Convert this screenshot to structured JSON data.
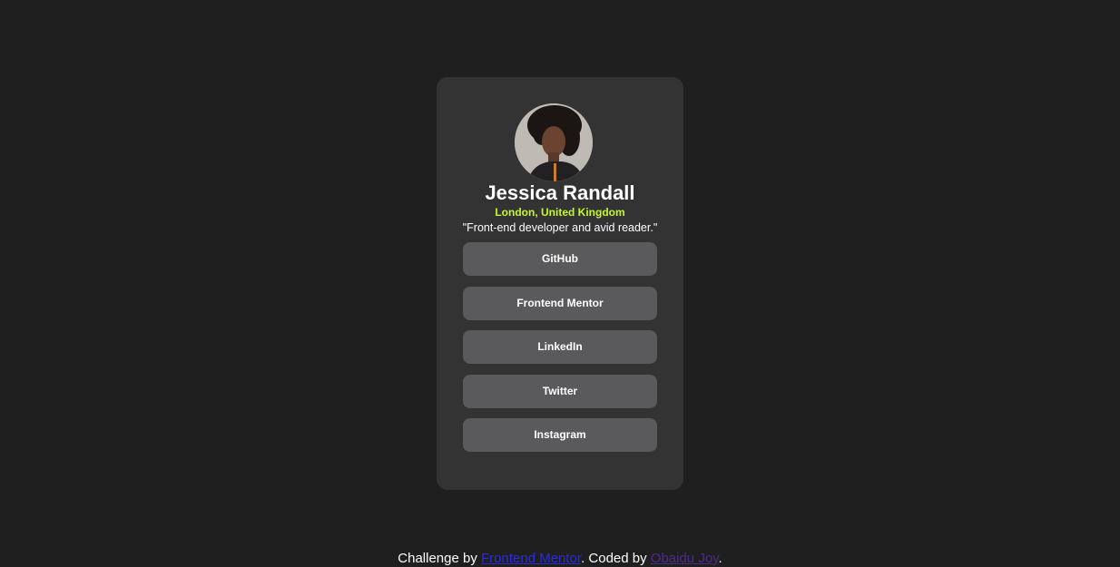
{
  "profile": {
    "name": "Jessica Randall",
    "location": "London, United Kingdom",
    "bio": "\"Front-end developer and avid reader.\""
  },
  "links": [
    {
      "label": "GitHub"
    },
    {
      "label": "Frontend Mentor"
    },
    {
      "label": "LinkedIn"
    },
    {
      "label": "Twitter"
    },
    {
      "label": "Instagram"
    }
  ],
  "footer": {
    "prefix": "Challenge by ",
    "challenge_link": "Frontend Mentor",
    "middle": ". Coded by ",
    "author_link": "Obaidu Joy",
    "suffix": "."
  },
  "colors": {
    "background": "#1f1f1f",
    "card": "#333333",
    "button": "#5a5a5c",
    "accent": "#c4f82a"
  }
}
